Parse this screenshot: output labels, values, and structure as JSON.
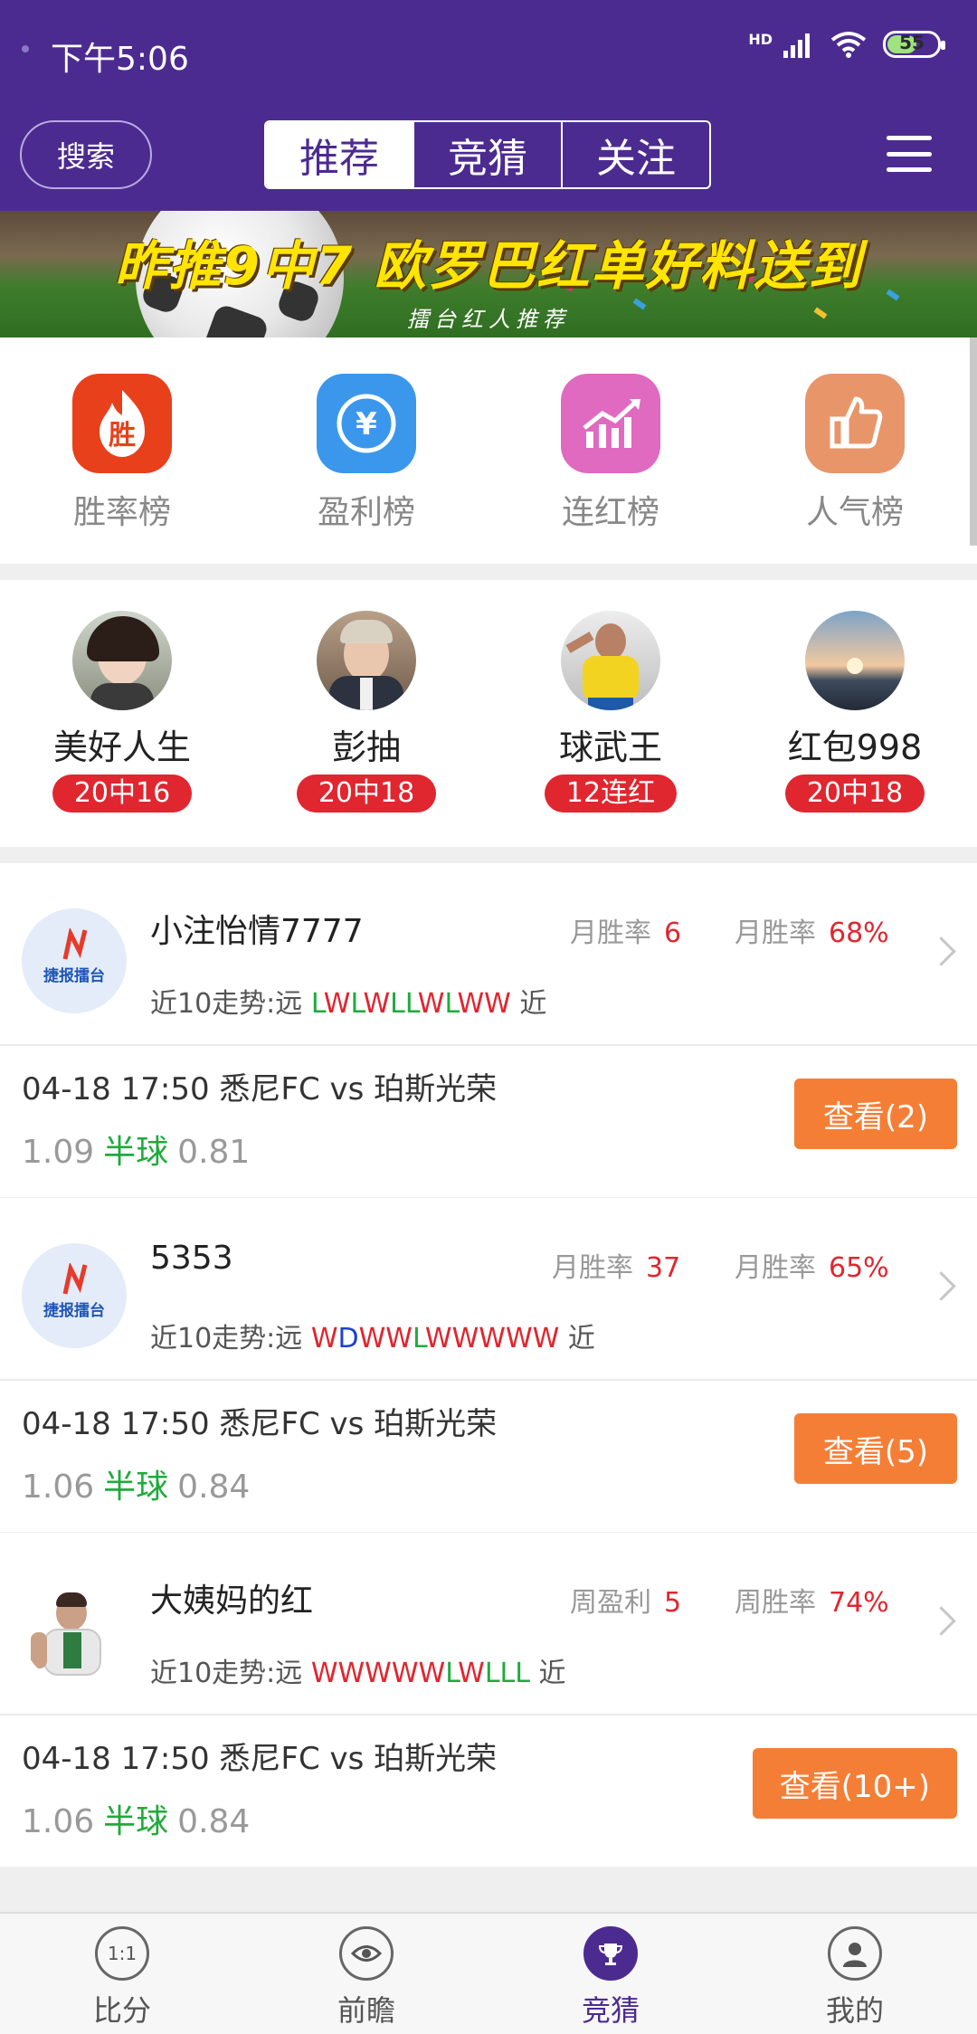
{
  "status_bar": {
    "time": "下午5:06",
    "network": "HD",
    "battery": "55"
  },
  "header": {
    "search_label": "搜索",
    "tabs": [
      {
        "label": "推荐",
        "active": true
      },
      {
        "label": "竞猜",
        "active": false
      },
      {
        "label": "关注",
        "active": false
      }
    ],
    "accent": "#4c2b91"
  },
  "banner": {
    "title": "昨推9中7 欧罗巴红单好料送到",
    "subtitle": "擂台红人推荐"
  },
  "categories": [
    {
      "label": "胜率榜",
      "icon": "win-flame-icon",
      "glyph": "胜",
      "color": "#e8401b"
    },
    {
      "label": "盈利榜",
      "icon": "yen-coin-icon",
      "glyph": "¥",
      "color": "#3b97ec"
    },
    {
      "label": "连红榜",
      "icon": "trend-chart-icon",
      "glyph": "",
      "color": "#e06ac0"
    },
    {
      "label": "人气榜",
      "icon": "thumbs-up-icon",
      "glyph": "👍",
      "color": "#e8956a"
    }
  ],
  "experts": [
    {
      "name": "美好人生",
      "record": "20中16"
    },
    {
      "name": "彭抽",
      "record": "20中18"
    },
    {
      "name": "球武王",
      "record": "12连红"
    },
    {
      "name": "红包998",
      "record": "20中18"
    }
  ],
  "cards": [
    {
      "name": "小注怡情7777",
      "stat1_label": "月胜率",
      "stat1_value": "6",
      "stat2_label": "月胜率",
      "stat2_value": "68%",
      "trend_prefix": "近10走势:远",
      "trend": "LWLWLLWLWW",
      "trend_suffix": "近",
      "match": "04-18 17:50 悉尼FC vs 珀斯光荣",
      "odds_left": "1.09",
      "handicap": "半球",
      "odds_right": "0.81",
      "button": "查看(2)",
      "logo_text": "捷报擂台"
    },
    {
      "name": "5353",
      "stat1_label": "月胜率",
      "stat1_value": "37",
      "stat2_label": "月胜率",
      "stat2_value": "65%",
      "trend_prefix": "近10走势:远",
      "trend": "WDWWLWWWWW",
      "trend_suffix": "近",
      "match": "04-18 17:50 悉尼FC vs 珀斯光荣",
      "odds_left": "1.06",
      "handicap": "半球",
      "odds_right": "0.84",
      "button": "查看(5)",
      "logo_text": "捷报擂台"
    },
    {
      "name": "大姨妈的红",
      "stat1_label": "周盈利",
      "stat1_value": "5",
      "stat2_label": "周胜率",
      "stat2_value": "74%",
      "trend_prefix": "近10走势:远",
      "trend": "WWWWWLWLLL",
      "trend_suffix": "近",
      "match": "04-18 17:50 悉尼FC vs 珀斯光荣",
      "odds_left": "1.06",
      "handicap": "半球",
      "odds_right": "0.84",
      "button": "查看(10+)",
      "logo_text": ""
    }
  ],
  "bottom_nav": [
    {
      "label": "比分",
      "icon": "score-icon",
      "glyph": "1:1",
      "active": false
    },
    {
      "label": "前瞻",
      "icon": "eye-icon",
      "glyph": "",
      "active": false
    },
    {
      "label": "竞猜",
      "icon": "trophy-icon",
      "glyph": "",
      "active": true
    },
    {
      "label": "我的",
      "icon": "profile-icon",
      "glyph": "",
      "active": false
    }
  ]
}
